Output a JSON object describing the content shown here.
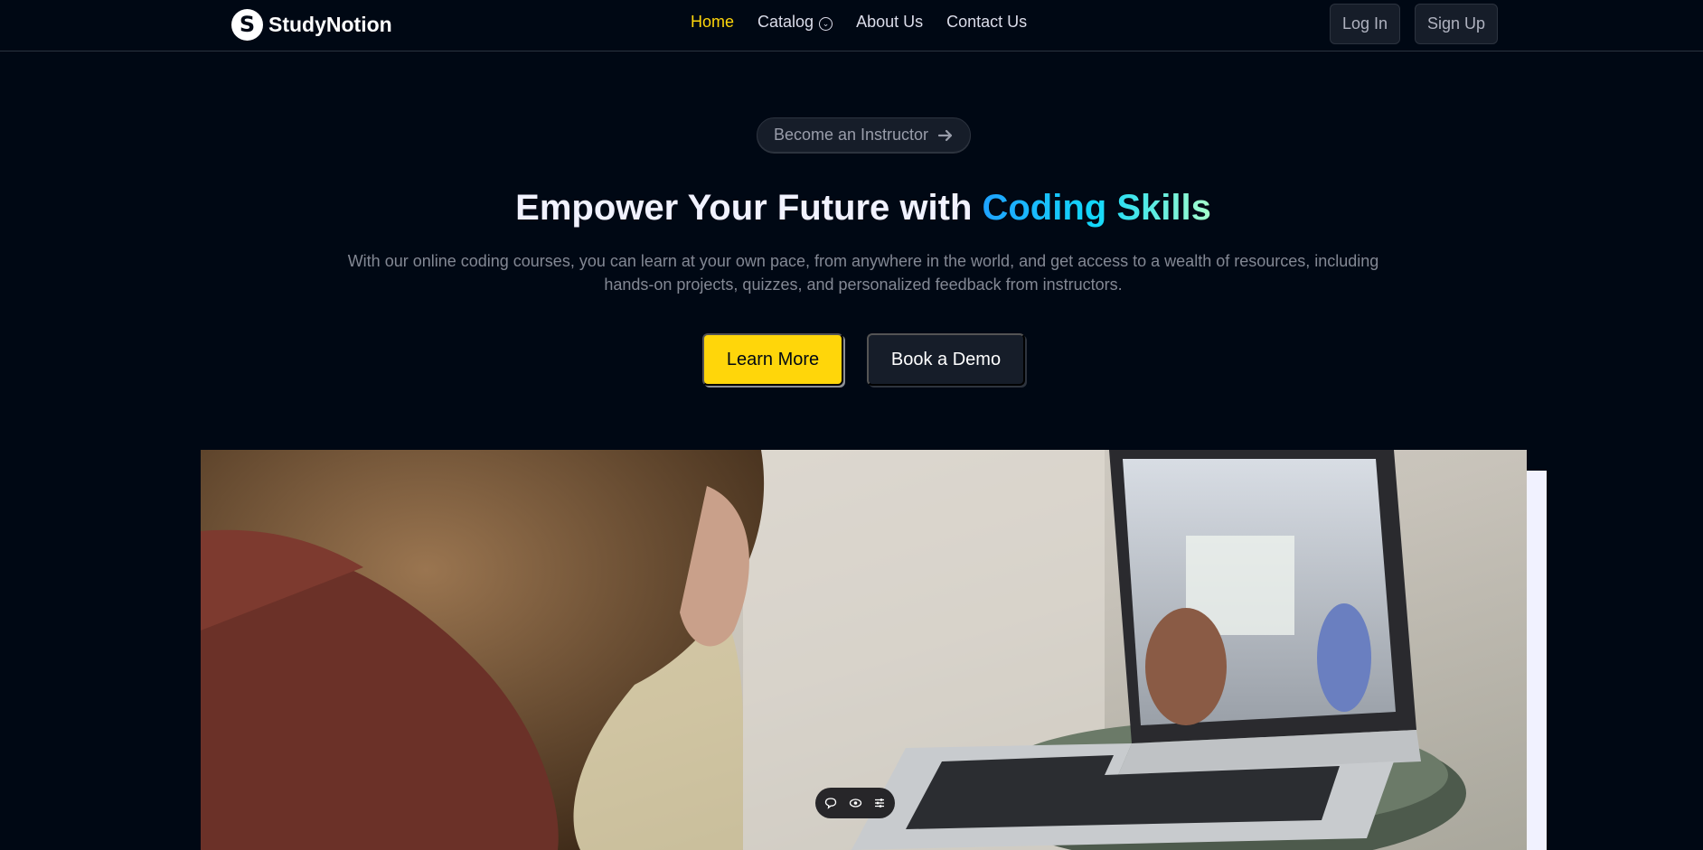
{
  "brand": {
    "logo_letter": "S",
    "name": "StudyNotion"
  },
  "nav": {
    "links": [
      {
        "label": "Home",
        "active": true
      },
      {
        "label": "Catalog",
        "has_dropdown": true
      },
      {
        "label": "About Us"
      },
      {
        "label": "Contact Us"
      }
    ],
    "login_label": "Log In",
    "signup_label": "Sign Up"
  },
  "hero": {
    "instructor_button": "Become an Instructor",
    "headline_prefix": "Empower Your Future with ",
    "headline_highlight": "Coding Skills",
    "description": "With our online coding courses, you can learn at your own pace, from anywhere in the world, and get access to a wealth of resources, including hands-on projects, quizzes, and personalized feedback from instructors.",
    "primary_button": "Learn More",
    "secondary_button": "Book a Demo"
  },
  "video": {
    "controls": [
      "chat-icon",
      "eye-icon",
      "settings-sliders-icon"
    ]
  },
  "colors": {
    "background": "#000814",
    "accent_yellow": "#FFD60A",
    "gradient_start": "#1FA2FF",
    "gradient_mid": "#12D8FA",
    "gradient_end": "#A6FFCB",
    "button_dark": "#161D29",
    "muted_text": "#838894"
  }
}
